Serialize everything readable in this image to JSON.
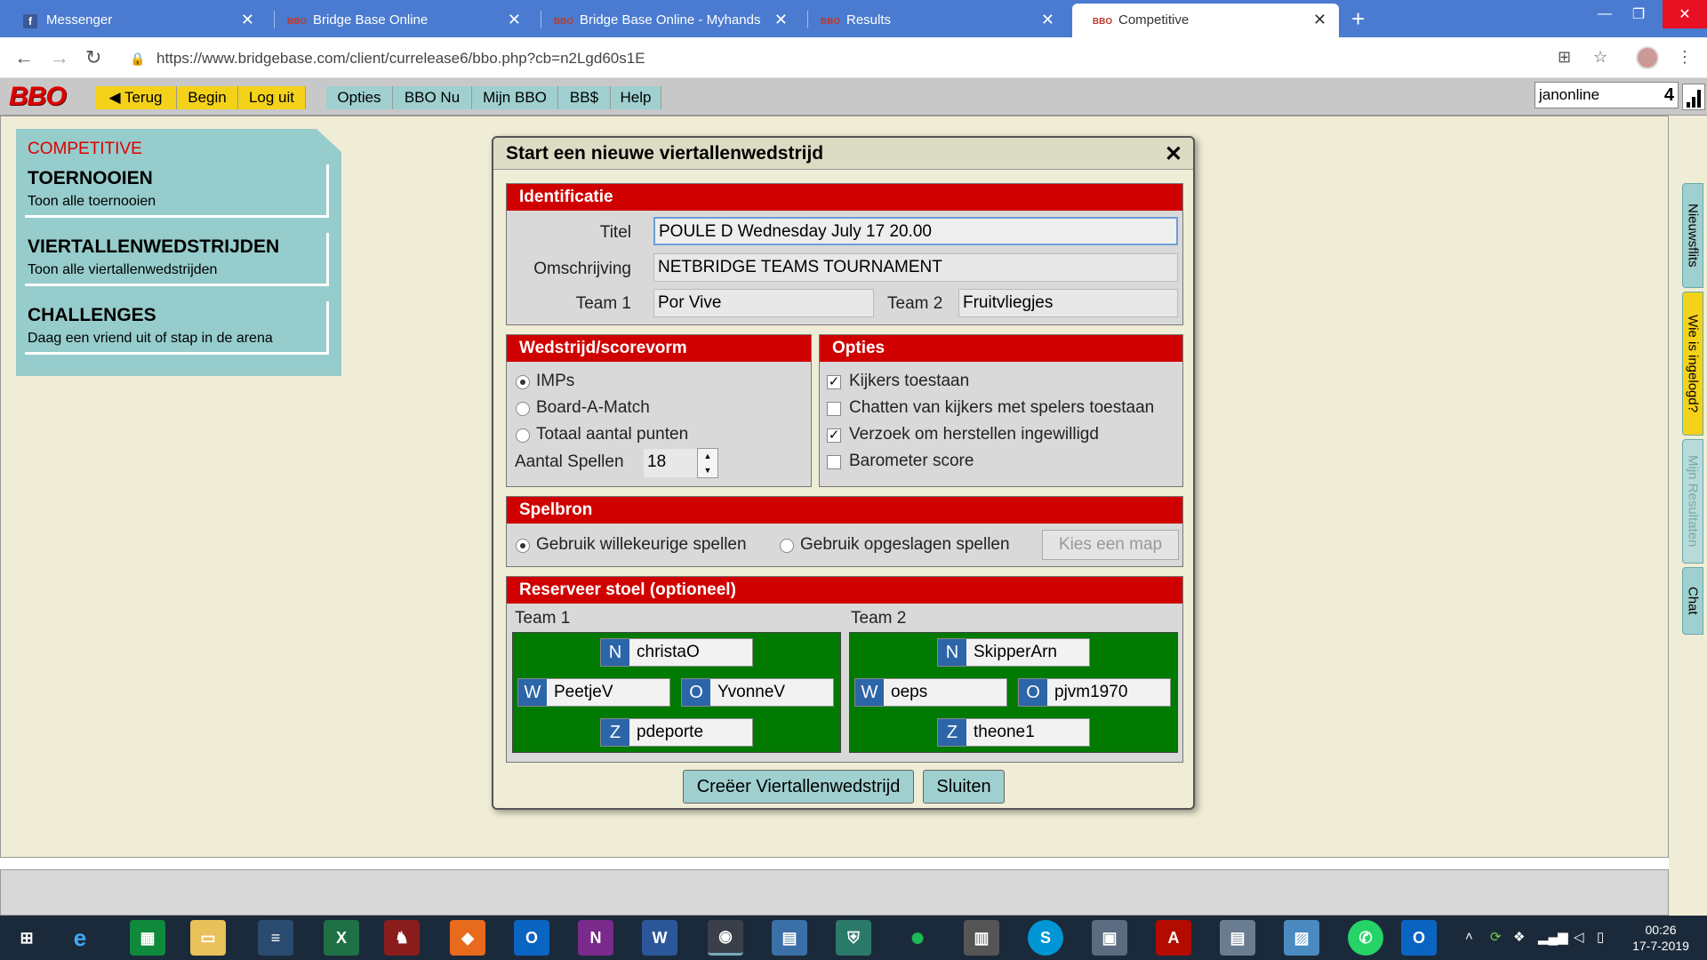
{
  "browser": {
    "tabs": [
      {
        "label": "Messenger",
        "icon": "messenger-icon"
      },
      {
        "label": "Bridge Base Online",
        "icon": "bbo-icon"
      },
      {
        "label": "Bridge Base Online - Myhands",
        "icon": "bbo-icon"
      },
      {
        "label": "Results",
        "icon": "bbo-icon"
      },
      {
        "label": "Competitive",
        "icon": "bbo-icon",
        "active": true
      }
    ],
    "url": "https://www.bridgebase.com/client/currelease6/bbo.php?cb=n2Lgd60s1E"
  },
  "toolbar": {
    "logo": "BBO",
    "back_label": "◀ Terug",
    "begin_label": "Begin",
    "logout_label": "Log uit",
    "options_label": "Opties",
    "bbo_now_label": "BBO Nu",
    "my_bbo_label": "Mijn BBO",
    "bbs_label": "BB$",
    "help_label": "Help",
    "username": "janonline",
    "count": "4"
  },
  "left_panel": {
    "title": "COMPETITIVE",
    "items": [
      {
        "heading": "TOERNOOIEN",
        "sub": "Toon alle toernooien"
      },
      {
        "heading": "VIERTALLENWEDSTRIJDEN",
        "sub": "Toon alle viertallenwedstrijden"
      },
      {
        "heading": "CHALLENGES",
        "sub": "Daag een vriend uit of stap in de arena"
      }
    ]
  },
  "side_tabs": {
    "news": "Nieuwsflits",
    "who": "Wie is ingelogd?",
    "results": "Mijn Resultaten",
    "chat": "Chat"
  },
  "dialog": {
    "title": "Start een nieuwe viertallenwedstrijd",
    "identification": {
      "header": "Identificatie",
      "title_label": "Titel",
      "title_value": "POULE D Wednesday July 17 20.00",
      "description_label": "Omschrijving",
      "description_value": "NETBRIDGE TEAMS TOURNAMENT",
      "team1_label": "Team 1",
      "team1_value": "Por Vive",
      "team2_label": "Team 2",
      "team2_value": "Fruitvliegjes"
    },
    "scoring": {
      "header": "Wedstrijd/scorevorm",
      "options": [
        "IMPs",
        "Board-A-Match",
        "Totaal aantal punten"
      ],
      "selected": "IMPs",
      "boards_label": "Aantal Spellen",
      "boards_value": "18"
    },
    "options": {
      "header": "Opties",
      "items": [
        {
          "label": "Kijkers toestaan",
          "checked": true
        },
        {
          "label": "Chatten van kijkers met spelers toestaan",
          "checked": false
        },
        {
          "label": "Verzoek om herstellen ingewilligd",
          "checked": true
        },
        {
          "label": "Barometer score",
          "checked": false
        }
      ]
    },
    "source": {
      "header": "Spelbron",
      "random_label": "Gebruik willekeurige spellen",
      "saved_label": "Gebruik opgeslagen spellen",
      "folder_button": "Kies een map"
    },
    "seats": {
      "header": "Reserveer stoel (optioneel)",
      "team1_label": "Team 1",
      "team2_label": "Team 2",
      "team1": {
        "N": "christaO",
        "W": "PeetjeV",
        "O": "YvonneV",
        "Z": "pdeporte"
      },
      "team2": {
        "N": "SkipperArn",
        "W": "oeps",
        "O": "pjvm1970",
        "Z": "theone1"
      },
      "dir_n": "N",
      "dir_w": "W",
      "dir_o": "O",
      "dir_z": "Z"
    },
    "create_button": "Creëer Viertallenwedstrijd",
    "close_button": "Sluiten"
  },
  "taskbar": {
    "time": "00:26",
    "date": "17-7-2019"
  }
}
